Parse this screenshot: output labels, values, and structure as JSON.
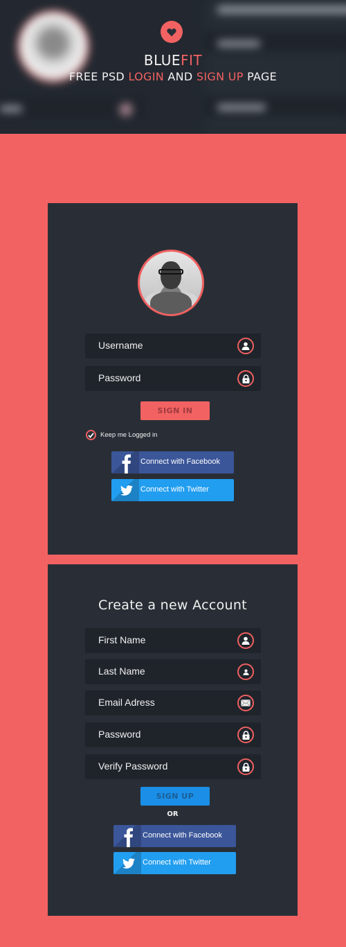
{
  "header": {
    "brand_part1": "BLUE",
    "brand_part2": "FIT",
    "tagline_part1": "FREE PSD ",
    "tagline_part2": "LOGIN",
    "tagline_part3": " AND ",
    "tagline_part4": "SIGN UP",
    "tagline_part5": " PAGE",
    "icon": "heart-icon"
  },
  "colors": {
    "accent": "#f26262",
    "panel": "#292e36",
    "field": "#1f242b",
    "facebook": "#3b5699",
    "twitter": "#229ef0",
    "signup_button": "#1b8fe8"
  },
  "login": {
    "avatar": "user-photo",
    "fields": [
      {
        "placeholder": "Username",
        "icon": "user-icon"
      },
      {
        "placeholder": "Password",
        "icon": "lock-icon"
      }
    ],
    "signin_label": "SIGN IN",
    "keep_logged_in_label": "Keep me Logged in",
    "keep_logged_in_checked": true,
    "facebook_label": "Connect with Facebook",
    "twitter_label": "Connect with Twitter"
  },
  "signup": {
    "title": "Create a new Account",
    "fields": [
      {
        "placeholder": "First Name",
        "icon": "user-icon"
      },
      {
        "placeholder": "Last Name",
        "icon": "user-icon"
      },
      {
        "placeholder": "Email Adress",
        "icon": "mail-icon"
      },
      {
        "placeholder": "Password",
        "icon": "lock-icon"
      },
      {
        "placeholder": "Verify Password",
        "icon": "lock-icon"
      }
    ],
    "signup_label": "SIGN UP",
    "or_label": "OR",
    "facebook_label": "Connect with Facebook",
    "twitter_label": "Connect with Twitter"
  }
}
